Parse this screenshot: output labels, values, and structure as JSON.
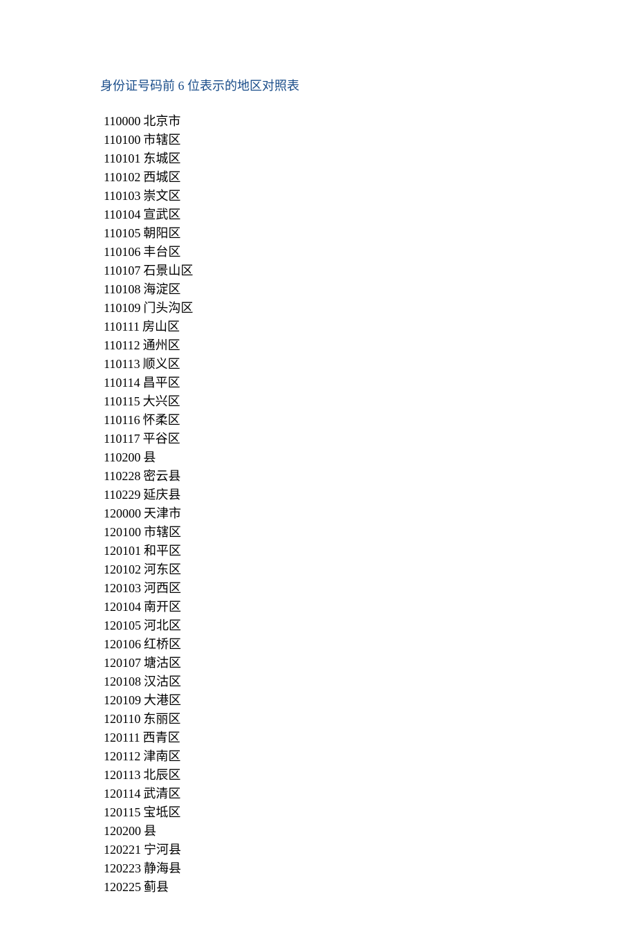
{
  "title_parts": {
    "t1": "身份证号码前",
    "t2": "6",
    "t3": "位表示的地区对照表"
  },
  "entries": [
    {
      "code": "110000",
      "name": "北京市"
    },
    {
      "code": "110100",
      "name": "市辖区"
    },
    {
      "code": "110101",
      "name": "东城区"
    },
    {
      "code": "110102",
      "name": "西城区"
    },
    {
      "code": "110103",
      "name": "崇文区"
    },
    {
      "code": "110104",
      "name": "宣武区"
    },
    {
      "code": "110105",
      "name": "朝阳区"
    },
    {
      "code": "110106",
      "name": "丰台区"
    },
    {
      "code": "110107",
      "name": "石景山区"
    },
    {
      "code": "110108",
      "name": "海淀区"
    },
    {
      "code": "110109",
      "name": "门头沟区"
    },
    {
      "code": "110111",
      "name": "房山区"
    },
    {
      "code": "110112",
      "name": "通州区"
    },
    {
      "code": "110113",
      "name": "顺义区"
    },
    {
      "code": "110114",
      "name": "昌平区"
    },
    {
      "code": "110115",
      "name": "大兴区"
    },
    {
      "code": "110116",
      "name": "怀柔区"
    },
    {
      "code": "110117",
      "name": "平谷区"
    },
    {
      "code": "110200",
      "name": "县"
    },
    {
      "code": "110228",
      "name": "密云县"
    },
    {
      "code": "110229",
      "name": "延庆县"
    },
    {
      "code": "120000",
      "name": "天津市"
    },
    {
      "code": "120100",
      "name": "市辖区"
    },
    {
      "code": "120101",
      "name": "和平区"
    },
    {
      "code": "120102",
      "name": "河东区"
    },
    {
      "code": "120103",
      "name": "河西区"
    },
    {
      "code": "120104",
      "name": "南开区"
    },
    {
      "code": "120105",
      "name": "河北区"
    },
    {
      "code": "120106",
      "name": "红桥区"
    },
    {
      "code": "120107",
      "name": "塘沽区"
    },
    {
      "code": "120108",
      "name": "汉沽区"
    },
    {
      "code": "120109",
      "name": "大港区"
    },
    {
      "code": "120110",
      "name": "东丽区"
    },
    {
      "code": "120111",
      "name": "西青区"
    },
    {
      "code": "120112",
      "name": "津南区"
    },
    {
      "code": "120113",
      "name": "北辰区"
    },
    {
      "code": "120114",
      "name": "武清区"
    },
    {
      "code": "120115",
      "name": "宝坻区"
    },
    {
      "code": "120200",
      "name": "县"
    },
    {
      "code": "120221",
      "name": "宁河县"
    },
    {
      "code": "120223",
      "name": "静海县"
    },
    {
      "code": "120225",
      "name": "蓟县"
    }
  ]
}
